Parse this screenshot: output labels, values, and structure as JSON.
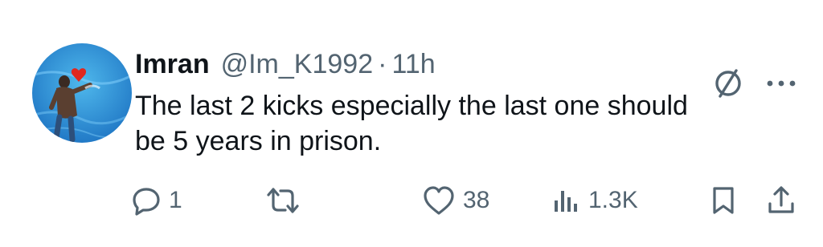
{
  "tweet": {
    "author": {
      "display_name": "Imran",
      "handle": "@Im_K1992",
      "separator": "·",
      "time_ago": "11h"
    },
    "text": "The last 2 kicks especially the last one should\nbe 5 years in prison.",
    "actions": {
      "replies": "1",
      "retweets": "",
      "likes": "38",
      "views": "1.3K"
    },
    "icons": {
      "avatar": "avatar",
      "grok": "grok-icon",
      "more": "more-icon",
      "reply": "reply-icon",
      "retweet": "retweet-icon",
      "like": "heart-icon",
      "views": "views-icon",
      "bookmark": "bookmark-icon",
      "share": "share-icon"
    },
    "colors": {
      "text_primary": "#0f1419",
      "text_secondary": "#536471",
      "background": "#ffffff"
    }
  }
}
